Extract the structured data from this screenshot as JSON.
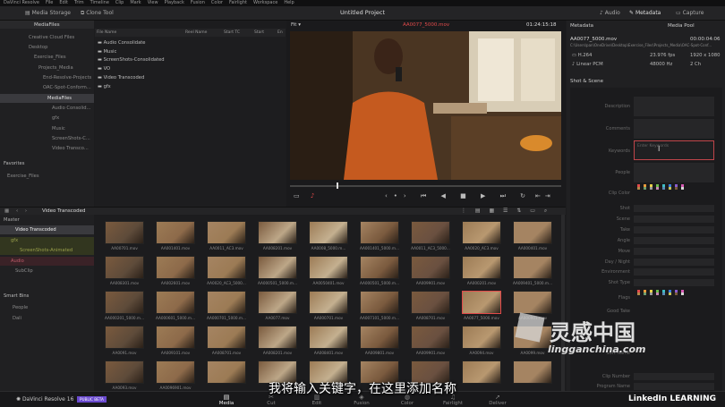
{
  "menu": [
    "DaVinci Resolve",
    "File",
    "Edit",
    "Trim",
    "Timeline",
    "Clip",
    "Mark",
    "View",
    "Playback",
    "Fusion",
    "Color",
    "Fairlight",
    "Workspace",
    "Help"
  ],
  "toolbar": {
    "media_storage": "Media Storage",
    "clone_tool": "Clone Tool",
    "project_title": "Untitled Project",
    "audio": "Audio",
    "metadata": "Metadata",
    "capture": "Capture"
  },
  "media_storage": {
    "header": "MediaFiles",
    "tree": [
      "Creative Cloud Files",
      "Desktop",
      "Exercise_Files",
      "Projects_Media",
      "End-Resolve-Projects",
      "OAC-Spot-Conform...",
      "MediaFiles",
      "Audio Consolid...",
      "gfx",
      "Music",
      "ScreenShots-C...",
      "Video Transco..."
    ],
    "columns": [
      "File Name",
      "Reel Name",
      "Start TC",
      "Start",
      "En"
    ],
    "files": [
      "Audio Consolidate",
      "Music",
      "ScreenShots-Consolidated",
      "VO",
      "Video Transcoded",
      "gfx"
    ]
  },
  "favorites": {
    "title": "Favorites",
    "items": [
      "Exercise_Files"
    ]
  },
  "viewer": {
    "fit": "Fit",
    "clip_name": "AA0077_5000.mov",
    "timecode": "01:24:15:18"
  },
  "media_pool": {
    "breadcrumb": "Video Transcoded",
    "bins": [
      "Master",
      "Video Transcoded",
      "gfx",
      "ScreenShots-Animated",
      "Audio",
      "SubClip"
    ],
    "smart_bins_title": "Smart Bins",
    "smart_bins": [
      "People",
      "Dali"
    ],
    "clips": [
      "AA00701.mov",
      "AA001401.mov",
      "AA0011_AC3.mov",
      "AA008201.mov",
      "AA0008_5000.m...",
      "AA001401_5000.m...",
      "AA0011_AC3_5000...",
      "AA0020_AC3.mov",
      "AA000401.mov",
      "AA008301.mov",
      "AA002601.mov",
      "AA0020_AC3_5000...",
      "AA000501_5000.m...",
      "AA0050401.mov",
      "AA000501_5000.m...",
      "AA009901.mov",
      "AA000201.mov",
      "AA009401_5000.m...",
      "AA000201_5000.m...",
      "AA000601_5000.m...",
      "AA000701_5000.m...",
      "AA0077.mov",
      "AA000701.mov",
      "AA007101_5000.m...",
      "AA008701.mov",
      "AA0077_5000.mov",
      "AA000901.mov",
      "AA0091.mov",
      "AA009101.mov",
      "AA008701.mov",
      "AA008201.mov",
      "AA008401.mov",
      "AA009801.mov",
      "AA009901.mov",
      "AA0094.mov",
      "AA0099.mov",
      "AA0093.mov",
      "AA0096901.mov",
      "",
      "",
      "",
      "",
      "",
      "",
      ""
    ]
  },
  "metadata_panel": {
    "title": "Metadata",
    "media_pool_btn": "Media Pool",
    "clip_name": "AA0077_5000.mov",
    "duration": "00:00:04:06",
    "path": "C:\\Users\\pan\\OneDrive\\Desktop\\Exercise_Files\\Projects_Media\\OAC-Spot-Conf...",
    "codec": "H.264",
    "fps": "23.976 fps",
    "resolution": "1920 x 1080",
    "audio_codec": "Linear PCM",
    "sample_rate": "48000 Hz",
    "channels": "2 Ch",
    "section": "Shot & Scene",
    "fields": [
      "Description",
      "Comments",
      "Keywords",
      "People",
      "Clip Color",
      "Shot",
      "Scene",
      "Take",
      "Angle",
      "Move",
      "Day / Night",
      "Environment",
      "Shot Type",
      "Flags",
      "Good Take",
      "",
      "Sort Name",
      "Clip Number",
      "Program Name"
    ],
    "keywords_placeholder": "Enter Keywords"
  },
  "pages": [
    "Media",
    "Cut",
    "Edit",
    "Fusion",
    "Color",
    "Fairlight",
    "Deliver"
  ],
  "app_name": "DaVinci Resolve 16",
  "beta_badge": "PUBLIC BETA",
  "subtitle": "我将输入关键字，在这里添加名称",
  "watermark_cn": "灵感中国",
  "watermark_url": "lingganchina.com",
  "linkedin": "LinkedIn LEARNING",
  "colors": {
    "accent": "#e14a4a",
    "selection": "#3a3a3e",
    "clip_purple": "#8a5ccf"
  }
}
